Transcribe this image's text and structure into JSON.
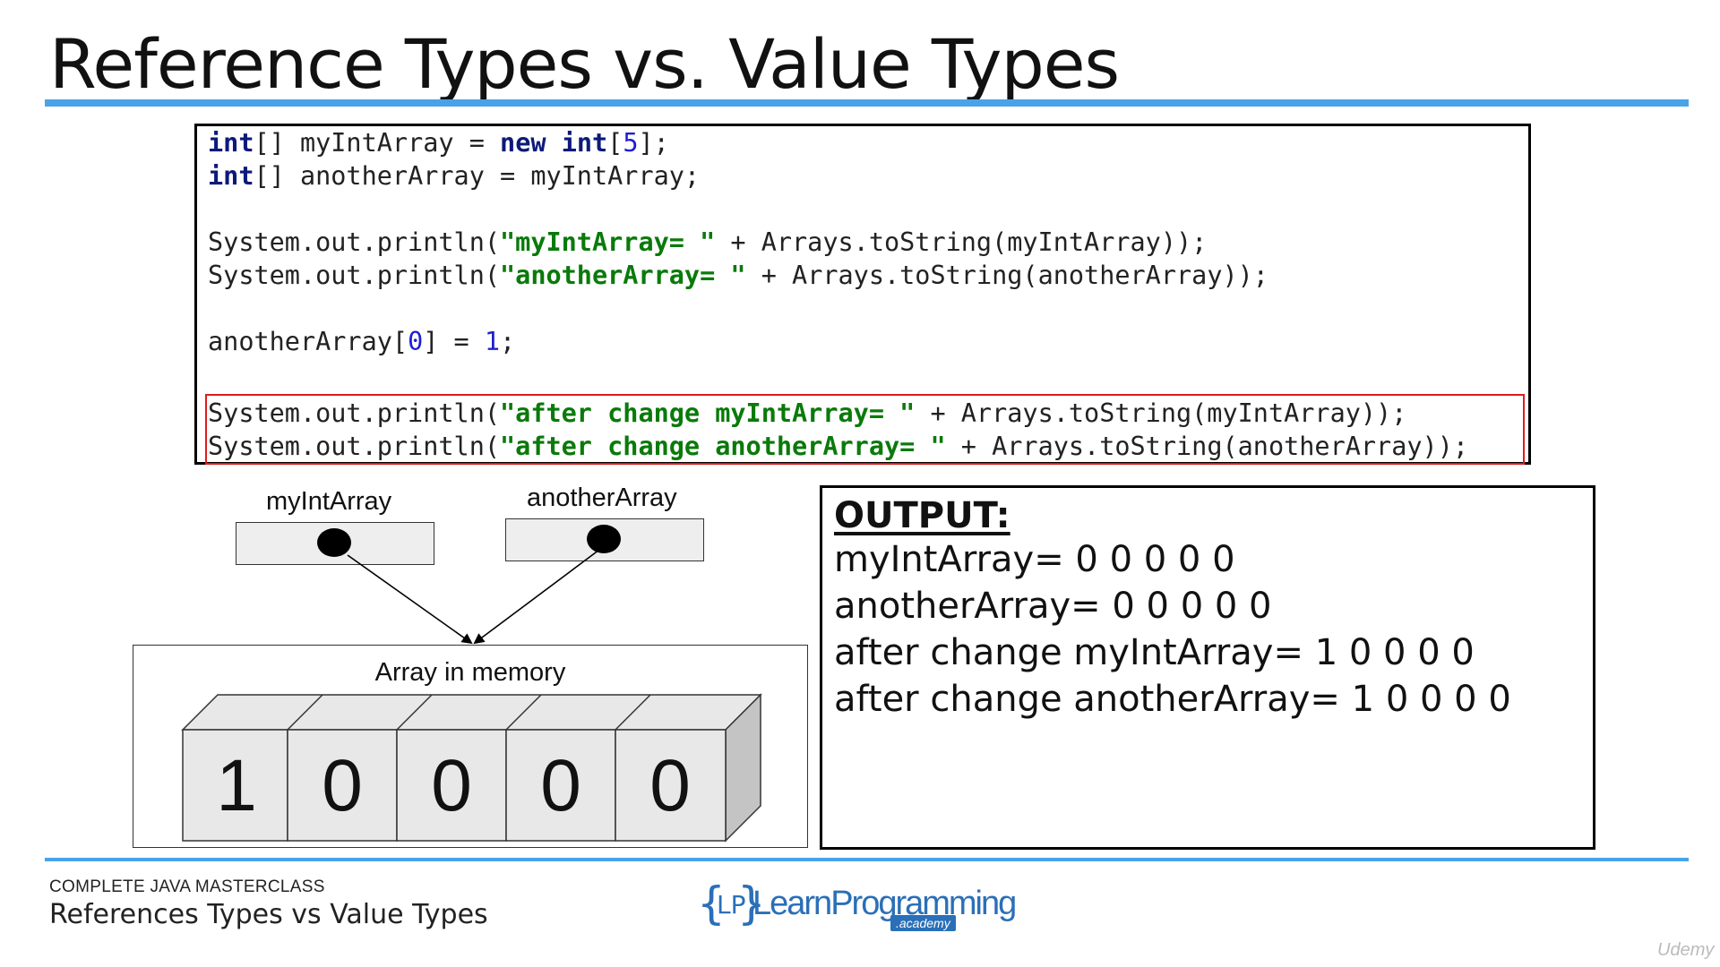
{
  "slide": {
    "title": "Reference Types vs. Value Types",
    "course": "COMPLETE JAVA MASTERCLASS",
    "subtitle": "References Types vs Value Types"
  },
  "code": {
    "line1": {
      "kw1": "int",
      "a": "[] myIntArray = ",
      "kw2": "new",
      "sp": " ",
      "kw3": "int",
      "b": "[",
      "num": "5",
      "c": "];"
    },
    "line2": {
      "kw1": "int",
      "a": "[] anotherArray = myIntArray;"
    },
    "line3": {
      "a": "System.out.println(",
      "str": "\"myIntArray= \"",
      "b": " + Arrays.toString(myIntArray));"
    },
    "line4": {
      "a": "System.out.println(",
      "str": "\"anotherArray= \"",
      "b": " + Arrays.toString(anotherArray));"
    },
    "line5": {
      "a": "anotherArray[",
      "num1": "0",
      "b": "] = ",
      "num2": "1",
      "c": ";"
    },
    "line6": {
      "a": "System.out.println(",
      "str": "\"after change myIntArray= \"",
      "b": " + Arrays.toString(myIntArray));"
    },
    "line7": {
      "a": "System.out.println(",
      "str": "\"after change anotherArray= \"",
      "b": " + Arrays.toString(anotherArray));"
    }
  },
  "diagram": {
    "ref1_label": "myIntArray",
    "ref2_label": "anotherArray",
    "memory_label": "Array in memory",
    "cells": [
      "1",
      "0",
      "0",
      "0",
      "0"
    ]
  },
  "output": {
    "heading": "OUTPUT:",
    "lines": [
      "myIntArray= 0 0 0 0 0",
      "anotherArray= 0 0 0 0 0",
      "after change myIntArray= 1 0 0 0 0",
      "after change anotherArray= 1 0 0 0 0"
    ]
  },
  "logo": {
    "brace_left": "{",
    "initials": "LP",
    "brace_right": "}",
    "name": "LearnProgramming",
    "sub": ".academy"
  },
  "watermark": "Udemy",
  "colors": {
    "accent": "#4aa3e8",
    "keyword": "#0d1a7a",
    "string": "#0a7a0a",
    "highlight": "#e01b1b"
  }
}
